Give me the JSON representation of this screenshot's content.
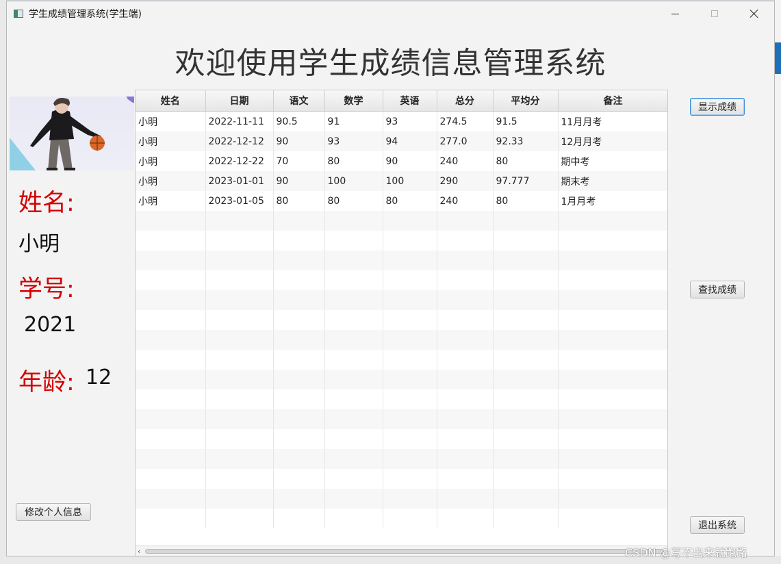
{
  "window": {
    "title": "学生成绩管理系统(学生端)"
  },
  "heading": "欢迎使用学生成绩信息管理系统",
  "profile": {
    "name_label": "姓名:",
    "name_value": "小明",
    "id_label": "学号:",
    "id_value": "2021",
    "age_label": "年龄:",
    "age_value": "12",
    "edit_button": "修改个人信息"
  },
  "actions": {
    "show_scores": "显示成绩",
    "find_scores": "查找成绩",
    "exit": "退出系统"
  },
  "table": {
    "columns": [
      "姓名",
      "日期",
      "语文",
      "数学",
      "英语",
      "总分",
      "平均分",
      "备注"
    ],
    "rows": [
      [
        "小明",
        "2022-11-11",
        "90.5",
        "91",
        "93",
        "274.5",
        "91.5",
        "11月月考"
      ],
      [
        "小明",
        "2022-12-12",
        "90",
        "93",
        "94",
        "277.0",
        "92.33",
        "12月月考"
      ],
      [
        "小明",
        "2022-12-22",
        "70",
        "80",
        "90",
        "240",
        "80",
        "期中考"
      ],
      [
        "小明",
        "2023-01-01",
        "90",
        "100",
        "100",
        "290",
        "97.777",
        "期末考"
      ],
      [
        "小明",
        "2023-01-05",
        "80",
        "80",
        "80",
        "240",
        "80",
        "1月月考"
      ]
    ]
  },
  "watermark": "CSDN @写不出来就跑路"
}
